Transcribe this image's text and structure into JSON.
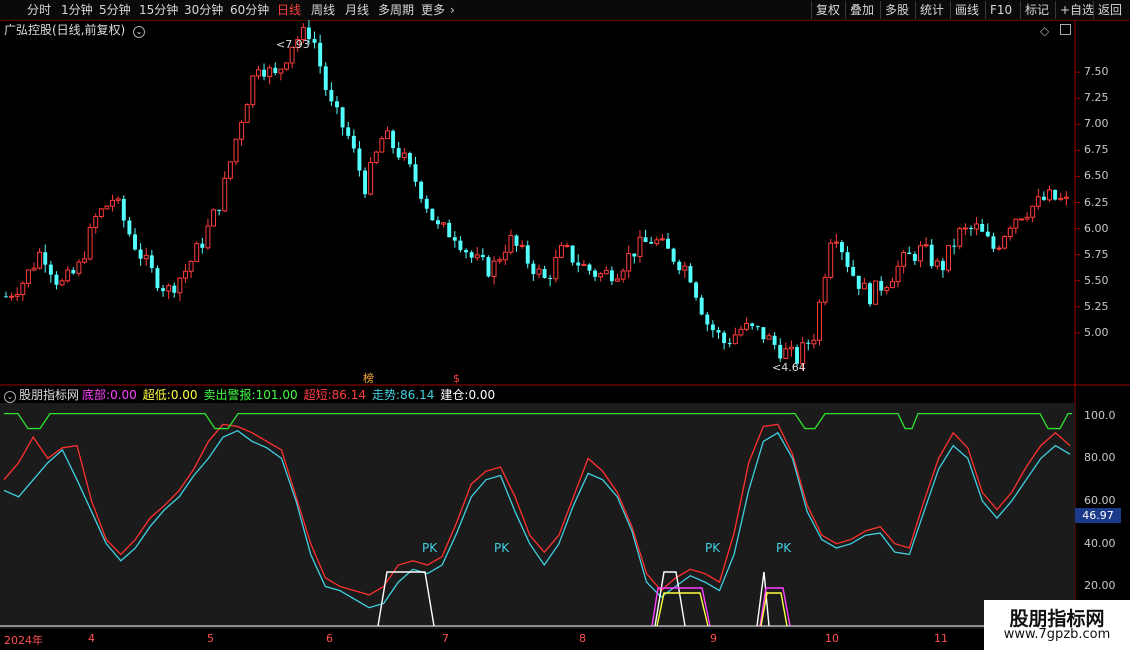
{
  "timeframes": [
    {
      "label": "分时",
      "active": false
    },
    {
      "label": "1分钟",
      "active": false
    },
    {
      "label": "5分钟",
      "active": false
    },
    {
      "label": "15分钟",
      "active": false
    },
    {
      "label": "30分钟",
      "active": false
    },
    {
      "label": "60分钟",
      "active": false
    },
    {
      "label": "日线",
      "active": true
    },
    {
      "label": "周线",
      "active": false
    },
    {
      "label": "月线",
      "active": false
    },
    {
      "label": "多周期",
      "active": false
    },
    {
      "label": "更多",
      "active": false
    }
  ],
  "tools": [
    "复权",
    "叠加",
    "多股",
    "统计",
    "画线",
    "F10",
    "标记",
    "+自选",
    "返回"
  ],
  "stock": {
    "name": "广弘控股(日线,前复权)"
  },
  "price_axis": [
    "7.50",
    "7.25",
    "7.00",
    "6.75",
    "6.50",
    "6.25",
    "6.00",
    "5.75",
    "5.50",
    "5.25",
    "5.00"
  ],
  "price_high_label": "7.93",
  "price_low_label": "4.64",
  "markers": [
    "榜",
    "$"
  ],
  "indicator": {
    "name": "股朋指标网",
    "params": [
      {
        "label": "底部:",
        "value": "0.00",
        "color": "#ff40ff"
      },
      {
        "label": "超低:",
        "value": "0.00",
        "color": "#ffff40"
      },
      {
        "label": "卖出警报:",
        "value": "101.00",
        "color": "#40ff40"
      },
      {
        "label": "超短:",
        "value": "86.14",
        "color": "#ff4040"
      },
      {
        "label": "走势:",
        "value": "86.14",
        "color": "#40d0e0"
      },
      {
        "label": "建仓:",
        "value": "0.00",
        "color": "#ffffff"
      }
    ],
    "axis": [
      "100.0",
      "80.00",
      "60.00",
      "40.00",
      "20.00"
    ],
    "current": "46.97",
    "pk_labels": [
      "PK",
      "PK",
      "PK",
      "PK"
    ]
  },
  "dates": [
    "2024年",
    "4",
    "5",
    "6",
    "7",
    "8",
    "9",
    "10",
    "11"
  ],
  "watermark": {
    "title": "股朋指标网",
    "url": "www.7gpzb.com"
  },
  "chart_data": {
    "type": "candlestick",
    "title": "广弘控股(日线,前复权)",
    "y_range": [
      4.5,
      8.0
    ],
    "high": 7.93,
    "low": 4.64,
    "price_path": [
      5.35,
      5.5,
      5.8,
      5.45,
      5.6,
      6.1,
      6.3,
      5.9,
      5.6,
      5.4,
      5.6,
      5.9,
      6.3,
      7.0,
      7.6,
      7.45,
      7.8,
      7.9,
      7.2,
      6.9,
      6.4,
      6.9,
      6.7,
      6.4,
      6.0,
      5.95,
      5.7,
      5.6,
      5.9,
      5.7,
      5.5,
      5.8,
      5.65,
      5.55,
      5.6,
      5.8,
      5.9,
      5.75,
      5.6,
      5.1,
      4.9,
      5.05,
      5.0,
      4.85,
      4.75,
      5.0,
      6.05,
      5.6,
      5.35,
      5.5,
      5.7,
      5.8,
      5.6,
      5.95,
      6.0,
      5.8,
      6.1,
      6.2,
      6.3,
      6.25
    ],
    "indicator_series": {
      "走势": [
        65,
        62,
        70,
        78,
        84,
        70,
        55,
        40,
        32,
        38,
        48,
        56,
        62,
        72,
        80,
        90,
        93,
        88,
        85,
        80,
        60,
        35,
        20,
        18,
        14,
        10,
        12,
        22,
        28,
        26,
        30,
        45,
        62,
        70,
        72,
        55,
        40,
        30,
        40,
        58,
        73,
        70,
        62,
        46,
        22,
        15,
        20,
        25,
        22,
        18,
        35,
        65,
        88,
        92,
        80,
        55,
        42,
        38,
        40,
        44,
        45,
        36,
        35,
        55,
        75,
        86,
        80,
        60,
        52,
        60,
        70,
        80,
        86,
        82
      ],
      "超短": [
        70,
        78,
        90,
        80,
        85,
        86,
        60,
        42,
        35,
        42,
        52,
        58,
        65,
        75,
        88,
        96,
        95,
        92,
        88,
        84,
        62,
        40,
        24,
        20,
        18,
        16,
        20,
        30,
        32,
        30,
        34,
        50,
        68,
        74,
        76,
        62,
        44,
        36,
        44,
        62,
        80,
        74,
        64,
        48,
        26,
        18,
        24,
        28,
        26,
        22,
        45,
        78,
        95,
        96,
        82,
        58,
        44,
        40,
        42,
        46,
        48,
        40,
        38,
        60,
        80,
        92,
        85,
        64,
        56,
        64,
        76,
        86,
        92,
        86
      ]
    }
  }
}
